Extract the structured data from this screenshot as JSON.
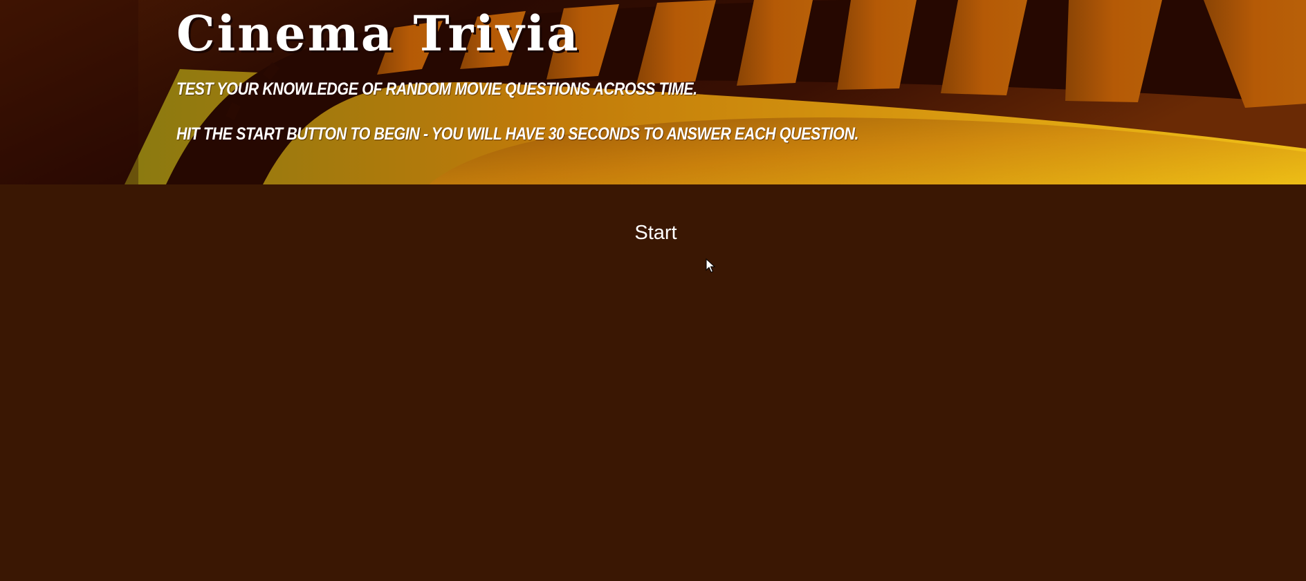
{
  "header": {
    "title": "Cinema Trivia",
    "tagline_1": "Test your knowledge of random movie questions across time.",
    "tagline_2": "Hit the start button to begin - you will have 30 seconds to answer each question."
  },
  "main": {
    "start_label": "Start"
  },
  "colors": {
    "page_background": "#3a1703",
    "banner_dark": "#2b0c02",
    "banner_orange": "#b05a0a",
    "banner_gold": "#e8b612",
    "text": "#ffffff"
  },
  "icons": {
    "banner": "film-strip",
    "pointer": "mouse-cursor-arrow"
  }
}
